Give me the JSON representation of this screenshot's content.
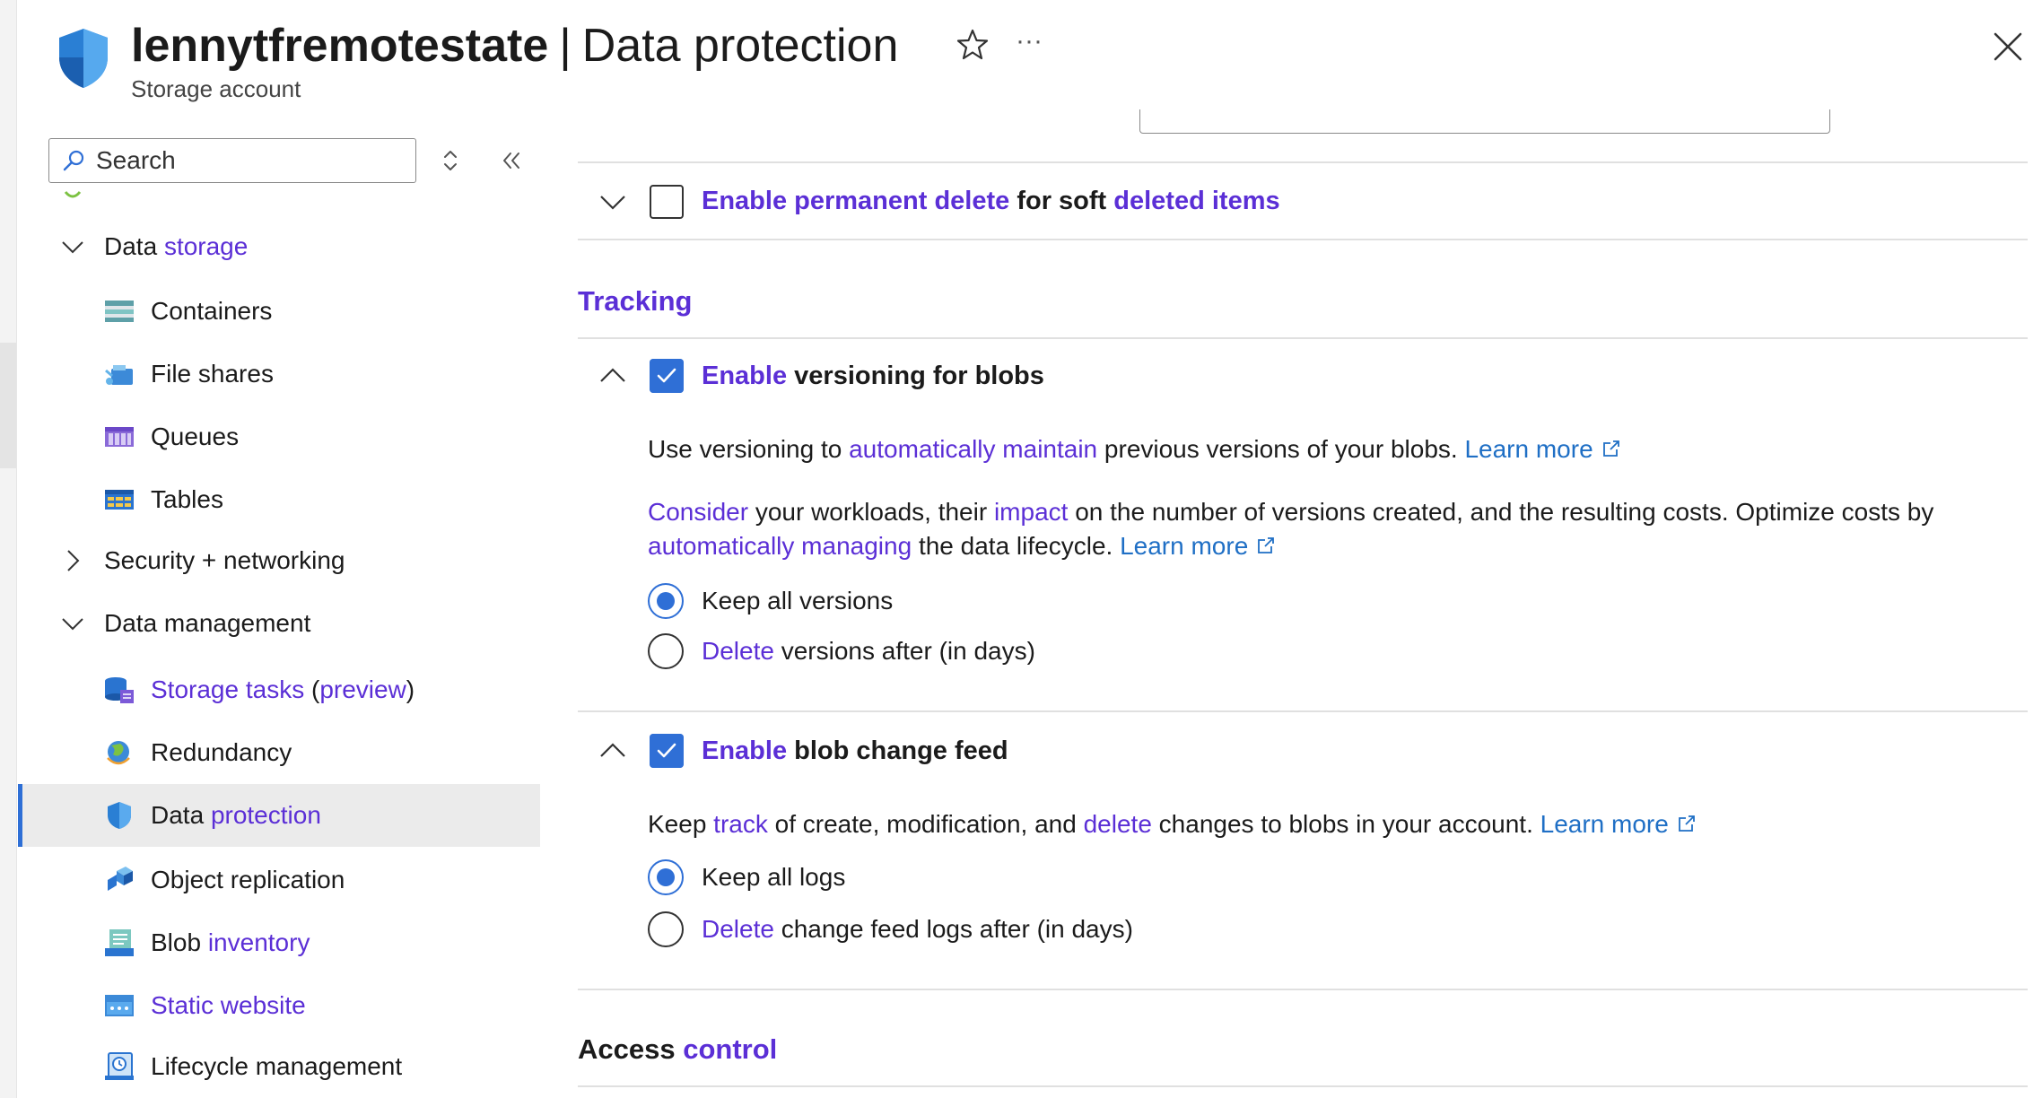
{
  "header": {
    "resource_name": "lennytfremotestate",
    "separator": "|",
    "page_name": "Data protection",
    "subtitle": "Storage account",
    "more_label": "···"
  },
  "sidebar": {
    "search_placeholder": "Search",
    "groups": {
      "data_storage": {
        "label_a": "Data",
        "label_b": "storage",
        "expanded": true
      },
      "security_networking": {
        "label": "Security + networking",
        "expanded": false
      },
      "data_management": {
        "label": "Data management",
        "expanded": true
      }
    },
    "items": {
      "containers": {
        "label": "Containers",
        "icon": "containers-icon"
      },
      "file_shares": {
        "label": "File shares",
        "icon": "file-shares-icon"
      },
      "queues": {
        "label": "Queues",
        "icon": "queues-icon"
      },
      "tables": {
        "label": "Tables",
        "icon": "tables-icon"
      },
      "storage_tasks": {
        "label_a": "Storage tasks",
        "label_b": "(",
        "label_c": "preview",
        "label_d": ")",
        "icon": "storage-tasks-icon"
      },
      "redundancy": {
        "label": "Redundancy",
        "icon": "globe-icon"
      },
      "data_protection": {
        "label_a": "Data",
        "label_b": "protection",
        "icon": "shield-icon",
        "selected": true
      },
      "object_replication": {
        "label": "Object replication",
        "icon": "object-replication-icon"
      },
      "blob_inventory": {
        "label_a": "Blob",
        "label_b": "inventory",
        "icon": "blob-inventory-icon"
      },
      "static_website": {
        "label": "Static website",
        "icon": "static-website-icon"
      },
      "lifecycle_management": {
        "label": "Lifecycle management",
        "icon": "lifecycle-icon"
      }
    }
  },
  "content": {
    "permanent_delete": {
      "label_1": "Enable permanent delete",
      "label_2": " for soft ",
      "label_3": "deleted items",
      "checked": false
    },
    "tracking_heading": "Tracking",
    "versioning": {
      "label_1": "Enable",
      "label_2": " versioning for blobs",
      "checked": true,
      "desc1_a": "Use versioning to ",
      "desc1_b": "automatically maintain",
      "desc1_c": " previous versions of your blobs. ",
      "learn_more": "Learn more",
      "desc2_a": "Consider",
      "desc2_b": " your workloads, their ",
      "desc2_c": "impact",
      "desc2_d": " on the number of versions created, and the resulting costs. Optimize costs by",
      "desc2_e": "automatically managing",
      "desc2_f": " the data lifecycle. ",
      "learn_more_2": "Learn more",
      "radio_keep": "Keep all versions",
      "radio_delete_a": "Delete",
      "radio_delete_b": " versions after (in days)",
      "selected_option": "Keep all versions"
    },
    "change_feed": {
      "label_1": "Enable",
      "label_2": " blob change feed",
      "checked": true,
      "desc_a": "Keep ",
      "desc_b": "track",
      "desc_c": " of create, modification, and ",
      "desc_d": "delete",
      "desc_e": " changes to blobs in your account. ",
      "learn_more": "Learn more",
      "radio_keep": "Keep all logs",
      "radio_delete_a": "Delete",
      "radio_delete_b": " change feed logs after (in days)",
      "selected_option": "Keep all logs"
    },
    "access_heading_a": "Access",
    "access_heading_b": "control"
  },
  "colors": {
    "accent_blue": "#2f6fd6",
    "link_blue": "#1f6fc5",
    "highlight_purple": "#5b2fd6",
    "selected_bg": "#ebebeb"
  }
}
